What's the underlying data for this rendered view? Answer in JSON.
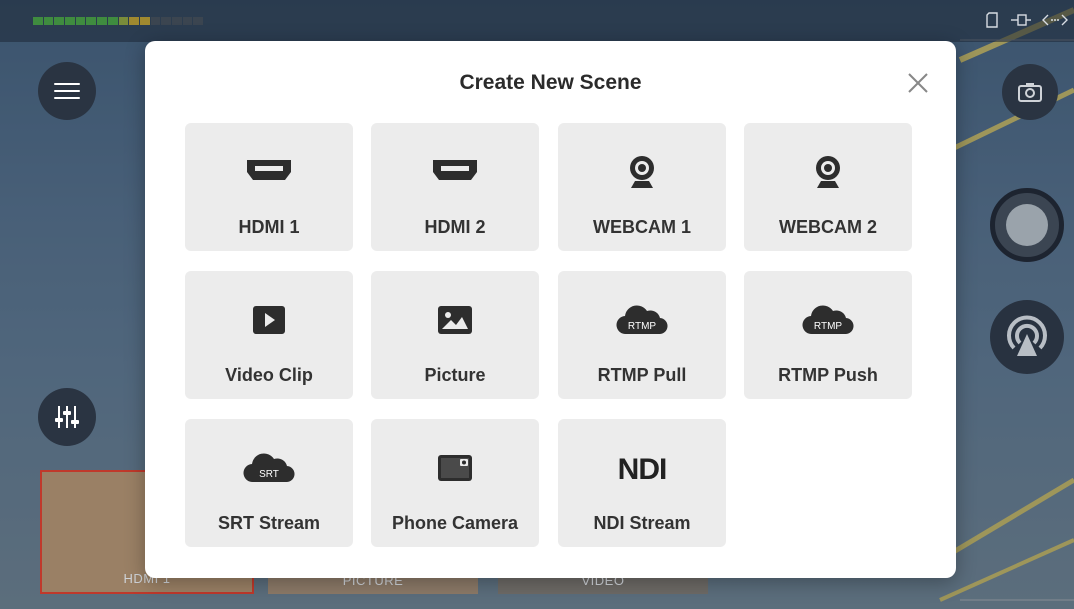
{
  "modal": {
    "title": "Create New Scene",
    "close_icon": "close-icon"
  },
  "scenes": [
    {
      "label": "HDMI 1",
      "icon": "hdmi-icon"
    },
    {
      "label": "HDMI 2",
      "icon": "hdmi-icon"
    },
    {
      "label": "WEBCAM 1",
      "icon": "webcam-icon"
    },
    {
      "label": "WEBCAM 2",
      "icon": "webcam-icon"
    },
    {
      "label": "Video Clip",
      "icon": "play-icon"
    },
    {
      "label": "Picture",
      "icon": "image-icon"
    },
    {
      "label": "RTMP Pull",
      "icon": "rtmp-cloud-icon",
      "badge": "RTMP"
    },
    {
      "label": "RTMP Push",
      "icon": "rtmp-cloud-icon",
      "badge": "RTMP"
    },
    {
      "label": "SRT Stream",
      "icon": "srt-cloud-icon",
      "badge": "SRT"
    },
    {
      "label": "Phone Camera",
      "icon": "phone-camera-icon"
    },
    {
      "label": "NDI Stream",
      "icon": "ndi-logo",
      "badge": "NDI"
    }
  ],
  "background": {
    "thumbnails": [
      "HDMI 1",
      "PICTURE",
      "VIDEO"
    ],
    "controls": [
      "menu-icon",
      "mixer-icon",
      "camera-icon",
      "record-icon",
      "live-broadcast-icon"
    ],
    "status_icons": [
      "sd-card-icon",
      "ethernet-icon",
      "network-icon"
    ]
  },
  "colors": {
    "tile_bg": "#ececec",
    "tile_text": "#333333",
    "icon_dark": "#2d2d2d",
    "modal_bg": "#ffffff"
  }
}
